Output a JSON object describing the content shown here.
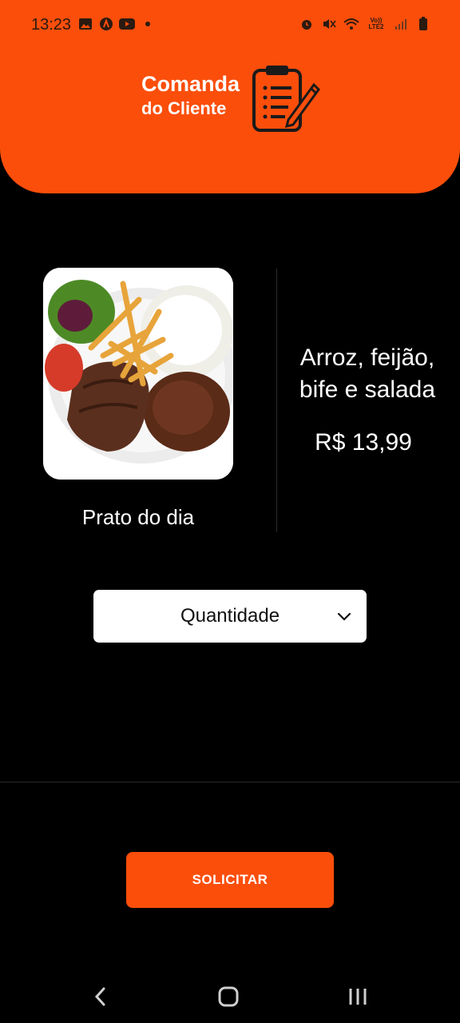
{
  "status_bar": {
    "time": "13:23",
    "left_icons": [
      "gallery-icon",
      "app-icon",
      "youtube-icon",
      "dot-icon"
    ],
    "right_icons": [
      "alarm-icon",
      "mute-icon",
      "wifi-icon",
      "volte-icon",
      "signal-icon",
      "battery-icon"
    ],
    "network_label": "Vo)) LTE2"
  },
  "header": {
    "title": "Comanda",
    "subtitle": "do Cliente",
    "icon": "clipboard-pen-icon",
    "color": "#fb4e0b"
  },
  "dish": {
    "image_label": "Prato do dia",
    "name": "Arroz, feijão, bife e salada",
    "price": "R$ 13,99"
  },
  "quantity_select": {
    "selected": "Quantidade"
  },
  "action": {
    "label": "SOLICITAR"
  },
  "navbar": {
    "icons": [
      "back-icon",
      "home-icon",
      "recents-icon"
    ]
  }
}
